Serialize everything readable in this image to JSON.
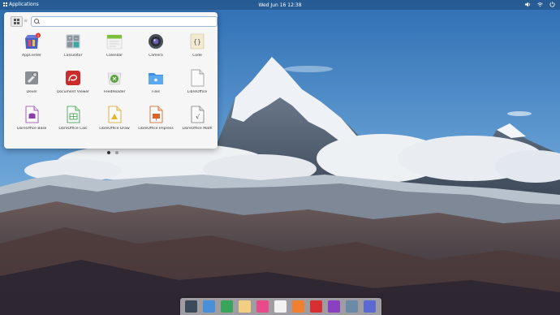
{
  "panel": {
    "applications_label": "Applications",
    "clock": "Wed Jun 16   12:38"
  },
  "launcher": {
    "search_placeholder": "",
    "apps": [
      {
        "label": "AppCenter",
        "icon": "appcenter-icon",
        "badge": "1"
      },
      {
        "label": "Calculator",
        "icon": "calculator-icon"
      },
      {
        "label": "Calendar",
        "icon": "calendar-icon"
      },
      {
        "label": "Camera",
        "icon": "camera-icon"
      },
      {
        "label": "Code",
        "icon": "code-icon"
      },
      {
        "label": "Devel",
        "icon": "devel-icon"
      },
      {
        "label": "Document Viewer",
        "icon": "document-viewer-icon"
      },
      {
        "label": "FeedReader",
        "icon": "feedreader-icon"
      },
      {
        "label": "Files",
        "icon": "files-icon"
      },
      {
        "label": "LibreOffice",
        "icon": "libreoffice-icon"
      },
      {
        "label": "LibreOffice Base",
        "icon": "libreoffice-base-icon"
      },
      {
        "label": "LibreOffice Calc",
        "icon": "libreoffice-calc-icon"
      },
      {
        "label": "LibreOffice Draw",
        "icon": "libreoffice-draw-icon"
      },
      {
        "label": "LibreOffice Impress",
        "icon": "libreoffice-impress-icon"
      },
      {
        "label": "LibreOffice Math",
        "icon": "libreoffice-math-icon"
      }
    ],
    "pages": 2,
    "active_page": 1
  },
  "dock": {
    "items": [
      {
        "icon": "multitasking-view-icon",
        "color": "#3d4a5c"
      },
      {
        "icon": "files-icon",
        "color": "#4a90d9"
      },
      {
        "icon": "web-browser-icon",
        "color": "#3aa55a"
      },
      {
        "icon": "mail-icon",
        "color": "#f0d080"
      },
      {
        "icon": "tasks-icon",
        "color": "#e84a8a"
      },
      {
        "icon": "calendar-icon",
        "color": "#f2f2f2"
      },
      {
        "icon": "music-icon",
        "color": "#f08030"
      },
      {
        "icon": "videos-icon",
        "color": "#d83030"
      },
      {
        "icon": "photos-icon",
        "color": "#8a40c0"
      },
      {
        "icon": "system-settings-icon",
        "color": "#6a8aa8"
      },
      {
        "icon": "appcenter-icon",
        "color": "#5a6ad0"
      }
    ]
  },
  "colors": {
    "sky_top": "#2f6fb4",
    "sky_bottom": "#bcd6ec",
    "launcher_bg": "#f6f6f6"
  }
}
